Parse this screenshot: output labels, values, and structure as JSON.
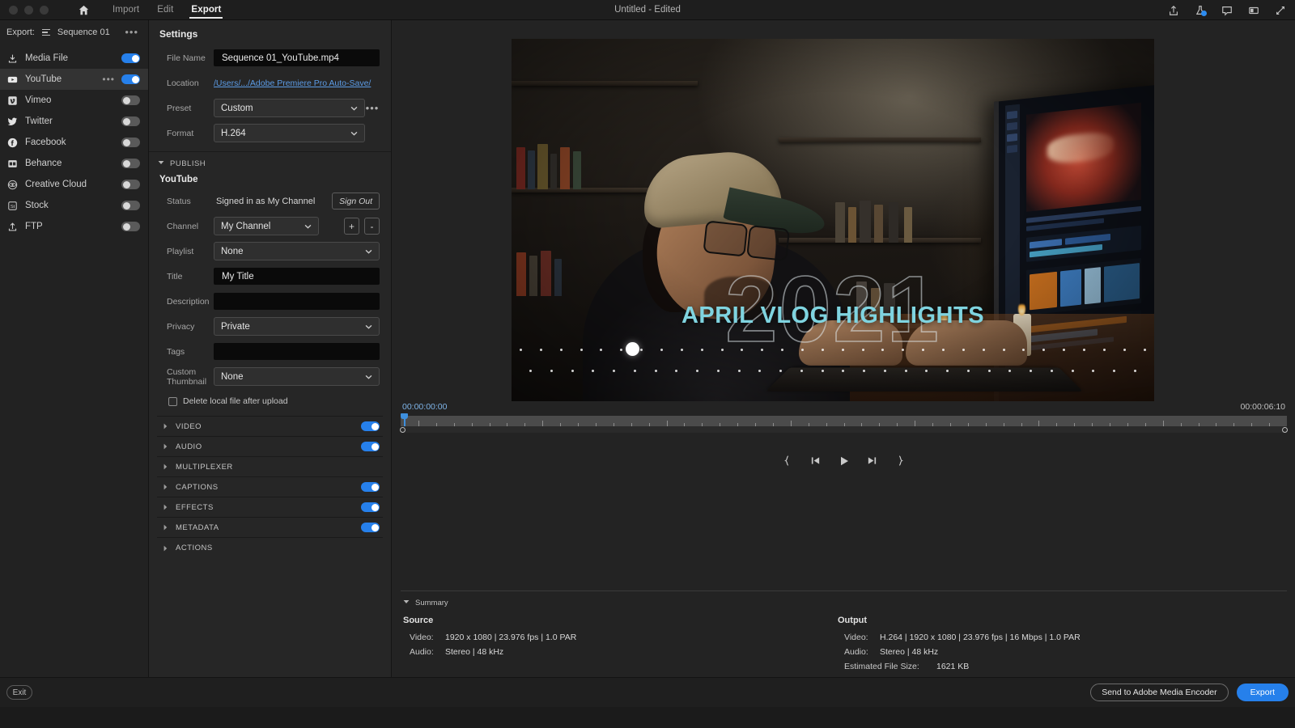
{
  "titlebar": {
    "home_icon": "home-icon",
    "tabs": [
      {
        "label": "Import",
        "active": false
      },
      {
        "label": "Edit",
        "active": false
      },
      {
        "label": "Export",
        "active": true
      }
    ],
    "window_title": "Untitled - Edited",
    "right_icons": [
      "share-icon",
      "beaker-icon",
      "comment-icon",
      "panel-icon",
      "fullscreen-icon"
    ]
  },
  "sidebar": {
    "export_label": "Export:",
    "sequence_name": "Sequence 01",
    "overflow_icon": "ellipsis-icon",
    "items": [
      {
        "label": "Media File",
        "icon": "media-file-icon",
        "toggle": true,
        "selected": false,
        "dots": false
      },
      {
        "label": "YouTube",
        "icon": "youtube-icon",
        "toggle": true,
        "selected": true,
        "dots": true
      },
      {
        "label": "Vimeo",
        "icon": "vimeo-icon",
        "toggle": false,
        "selected": false,
        "dots": false
      },
      {
        "label": "Twitter",
        "icon": "twitter-icon",
        "toggle": false,
        "selected": false,
        "dots": false
      },
      {
        "label": "Facebook",
        "icon": "facebook-icon",
        "toggle": false,
        "selected": false,
        "dots": false
      },
      {
        "label": "Behance",
        "icon": "behance-icon",
        "toggle": false,
        "selected": false,
        "dots": false
      },
      {
        "label": "Creative Cloud",
        "icon": "creative-cloud-icon",
        "toggle": false,
        "selected": false,
        "dots": false
      },
      {
        "label": "Stock",
        "icon": "stock-icon",
        "toggle": false,
        "selected": false,
        "dots": false
      },
      {
        "label": "FTP",
        "icon": "ftp-icon",
        "toggle": false,
        "selected": false,
        "dots": false
      }
    ]
  },
  "settings": {
    "title": "Settings",
    "file_name": {
      "label": "File Name",
      "value": "Sequence 01_YouTube.mp4"
    },
    "location": {
      "label": "Location",
      "value": "/Users/.../Adobe Premiere Pro Auto-Save/"
    },
    "preset": {
      "label": "Preset",
      "value": "Custom",
      "overflow_icon": "ellipsis-icon"
    },
    "format": {
      "label": "Format",
      "value": "H.264"
    }
  },
  "publish": {
    "section_label": "PUBLISH",
    "provider": "YouTube",
    "status": {
      "label": "Status",
      "value": "Signed in as My Channel",
      "sign_out": "Sign Out"
    },
    "channel": {
      "label": "Channel",
      "value": "My Channel",
      "add": "+",
      "remove": "-"
    },
    "playlist": {
      "label": "Playlist",
      "value": "None"
    },
    "title_field": {
      "label": "Title",
      "value": "My Title"
    },
    "description": {
      "label": "Description",
      "value": ""
    },
    "privacy": {
      "label": "Privacy",
      "value": "Private"
    },
    "tags": {
      "label": "Tags",
      "value": ""
    },
    "custom_thumbnail": {
      "label": "Custom Thumbnail",
      "label_line1": "Custom",
      "label_line2": "Thumbnail",
      "value": "None"
    },
    "delete_local": {
      "label": "Delete local file after upload",
      "checked": false
    }
  },
  "accordion": [
    {
      "label": "VIDEO",
      "toggle": true
    },
    {
      "label": "AUDIO",
      "toggle": true
    },
    {
      "label": "MULTIPLEXER",
      "toggle": null
    },
    {
      "label": "CAPTIONS",
      "toggle": true
    },
    {
      "label": "EFFECTS",
      "toggle": true
    },
    {
      "label": "METADATA",
      "toggle": true
    },
    {
      "label": "ACTIONS",
      "toggle": null
    }
  ],
  "preview": {
    "overlay_year": "2021",
    "overlay_title": "APRIL VLOG HIGHLIGHTS",
    "timecode_start": "00:00:00:00",
    "timecode_end": "00:00:06:10",
    "transport_icons": [
      "mark-in-icon",
      "step-back-icon",
      "play-icon",
      "step-forward-icon",
      "mark-out-icon"
    ]
  },
  "summary": {
    "section_label": "Summary",
    "source": {
      "title": "Source",
      "rows": [
        {
          "key": "Video:",
          "value": "1920 x 1080 | 23.976 fps | 1.0 PAR"
        },
        {
          "key": "Audio:",
          "value": "Stereo | 48 kHz"
        }
      ]
    },
    "output": {
      "title": "Output",
      "rows": [
        {
          "key": "Video:",
          "value": "H.264 | 1920 x 1080 | 23.976 fps | 16 Mbps | 1.0 PAR"
        },
        {
          "key": "Audio:",
          "value": "Stereo | 48 kHz"
        },
        {
          "key": "Estimated File Size:",
          "value": "1621 KB"
        }
      ]
    }
  },
  "bottombar": {
    "exit": "Exit",
    "send_to_ame": "Send to Adobe Media Encoder",
    "export": "Export"
  },
  "colors": {
    "accent_blue": "#2680eb",
    "link_blue": "#5c9ce6",
    "title_cyan": "#7fd4e0",
    "panel_bg": "#262626",
    "sidebar_bg": "#222222"
  }
}
